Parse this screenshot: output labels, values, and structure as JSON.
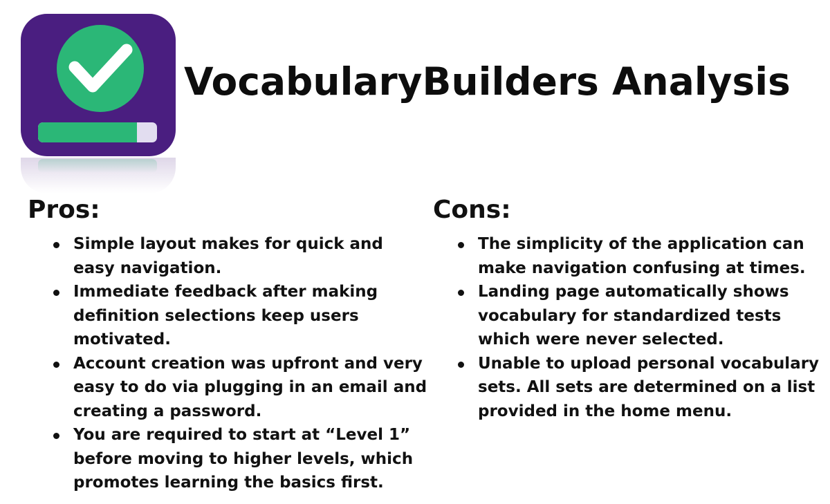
{
  "app": {
    "name": "VocabularyBuilders",
    "icon": "vocabularybuilders-app-icon",
    "progress_fraction": 0.83,
    "colors": {
      "background": "#4a1e80",
      "accent": "#2bb777",
      "check": "#ffffff",
      "track": "#e2ddf0"
    }
  },
  "title": "VocabularyBuilders Analysis",
  "pros": {
    "heading": "Pros:",
    "items": [
      "Simple layout makes for quick and easy navigation.",
      "Immediate feedback after making definition selections keep users motivated.",
      "Account creation was upfront and very easy to do via plugging in an email and creating a password.",
      "You are required to start at “Level 1” before moving to higher levels, which promotes learning the basics first."
    ]
  },
  "cons": {
    "heading": "Cons:",
    "items": [
      "The simplicity of the application can make navigation confusing at times.",
      "Landing page automatically shows vocabulary for standardized tests which were never selected.",
      "Unable to upload personal vocabulary sets. All sets are determined on a list provided in the home menu."
    ]
  }
}
